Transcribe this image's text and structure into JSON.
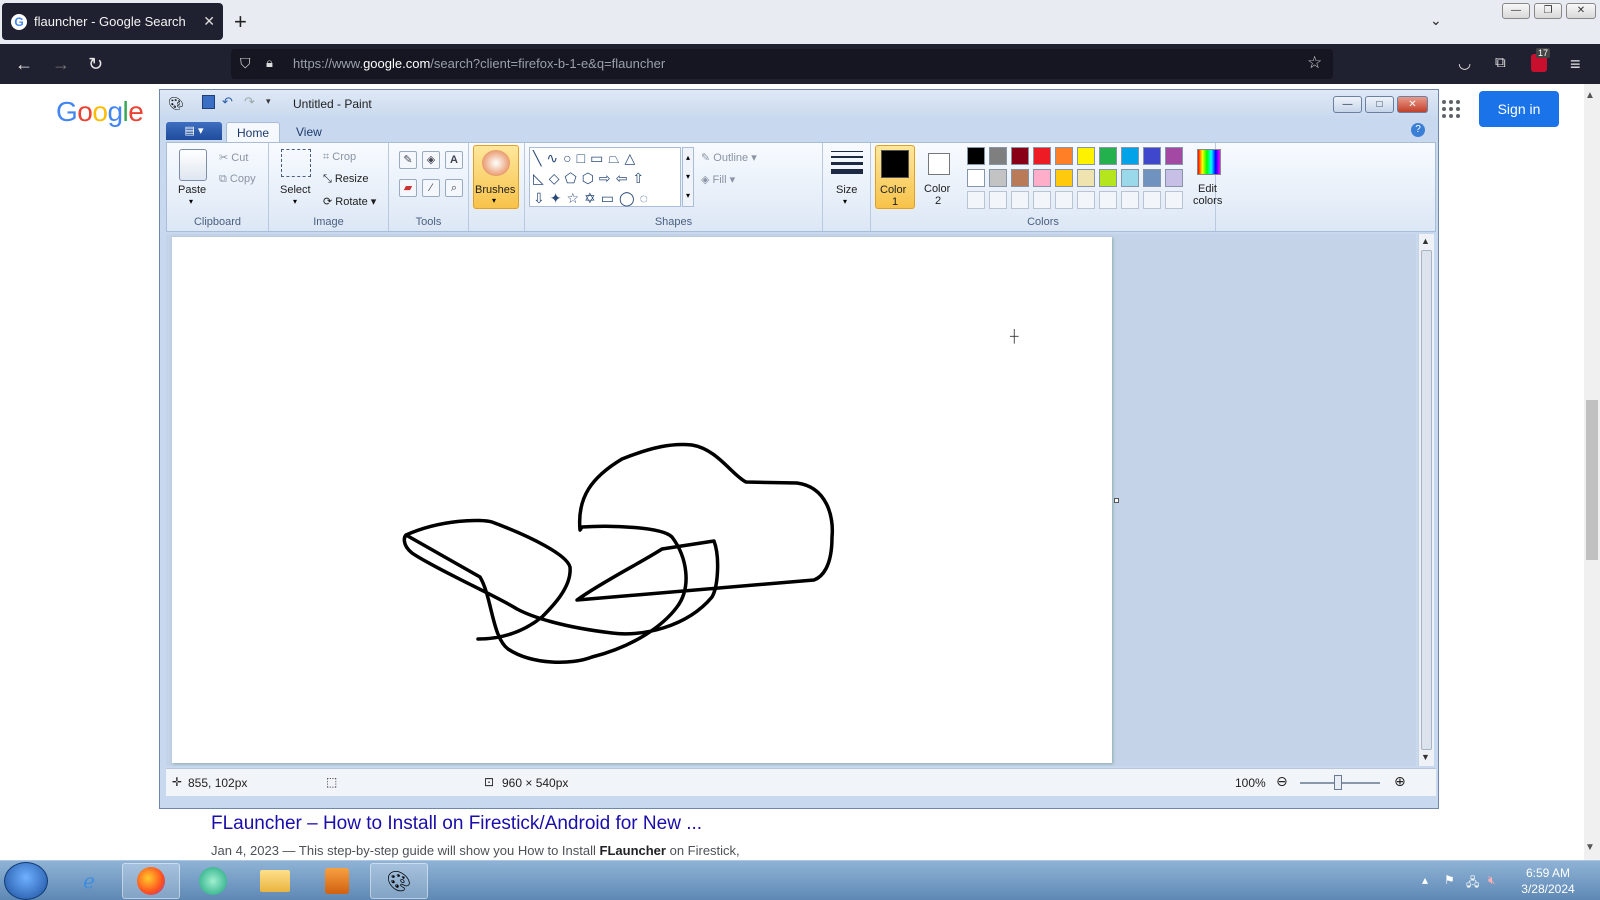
{
  "browser": {
    "tab_title": "flauncher - Google Search",
    "tab_icon": "G",
    "new_tab": "+",
    "url_prefix": "https://www.",
    "url_domain": "google.com",
    "url_rest": "/search?client=firefox-b-1-e&q=flauncher",
    "badge_count": "17"
  },
  "google": {
    "logo": "Google",
    "sign_in": "Sign in",
    "result_title": "FLauncher – How to Install on Firestick/Android for New ...",
    "result_date": "Jan 4, 2023 — This step-by-step guide will show you How to Install ",
    "result_bold": "FLauncher",
    "result_tail": " on Firestick,"
  },
  "paint": {
    "title": "Untitled - Paint",
    "tabs": [
      "Home",
      "View"
    ],
    "clipboard": {
      "paste": "Paste",
      "cut": "Cut",
      "copy": "Copy",
      "label": "Clipboard"
    },
    "image": {
      "select": "Select",
      "crop": "Crop",
      "resize": "Resize",
      "rotate": "Rotate",
      "label": "Image"
    },
    "tools": {
      "label": "Tools"
    },
    "brushes": "Brushes",
    "shapes": {
      "outline": "Outline",
      "fill": "Fill",
      "label": "Shapes"
    },
    "size": "Size",
    "color1": {
      "label": "Color",
      "num": "1"
    },
    "color2": {
      "label": "Color",
      "num": "2"
    },
    "colors_label": "Colors",
    "edit_colors": [
      "Edit",
      "colors"
    ],
    "palette": [
      "#000000",
      "#7f7f7f",
      "#880015",
      "#ed1c24",
      "#ff7f27",
      "#fff200",
      "#22b14c",
      "#00a2e8",
      "#3f48cc",
      "#a349a4",
      "#ffffff",
      "#c3c3c3",
      "#b97a57",
      "#ffaec9",
      "#ffc90e",
      "#efe4b0",
      "#b5e61d",
      "#99d9ea",
      "#7092be",
      "#c8bfe7"
    ],
    "status": {
      "cursor": "855, 102px",
      "dimensions": "960 × 540px",
      "zoom": "100%"
    }
  },
  "taskbar": {
    "time": "6:59 AM",
    "date": "3/28/2024"
  }
}
